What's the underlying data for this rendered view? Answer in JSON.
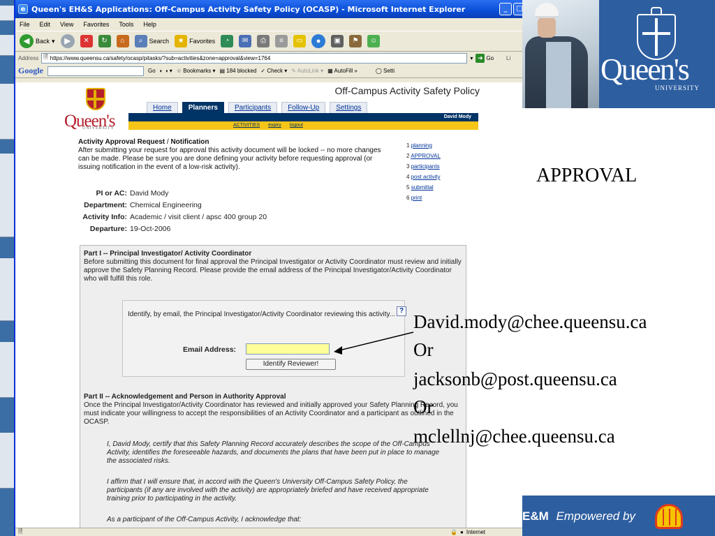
{
  "browser": {
    "title": "Queen's EH&S Applications: Off-Campus Activity Safety Policy (OCASP) - Microsoft Internet Explorer",
    "menu": [
      "File",
      "Edit",
      "View",
      "Favorites",
      "Tools",
      "Help"
    ],
    "toolbar": {
      "back": "Back",
      "search": "Search",
      "favorites": "Favorites"
    },
    "address_label": "Address",
    "url": "https://www.queensu.ca/safety/ocasp/pitasks/?sub=activities&zone=approval&view=1764",
    "go": "Go",
    "links": "Li",
    "google_toolbar": {
      "logo": "Google",
      "go": "Go",
      "bookmarks": "Bookmarks",
      "blocked": "184 blocked",
      "check": "Check",
      "autolink": "AutoLink",
      "autofill": "AutoFill",
      "settings": "Setti"
    },
    "status_zone": "Internet"
  },
  "page": {
    "logo_word": "Queen's",
    "logo_univ": "UNIVERSITY",
    "title": "Off-Campus Activity Safety Policy",
    "tabs": [
      {
        "label": "Home",
        "active": false
      },
      {
        "label": "Planners",
        "active": true
      },
      {
        "label": "Participants",
        "active": false
      },
      {
        "label": "Follow-Up",
        "active": false
      },
      {
        "label": "Settings",
        "active": false
      }
    ],
    "user": "David Mody",
    "subnav": [
      "ACTIVITIES",
      "expiry",
      "logout"
    ],
    "approval_heading_a": "Activity Approval Request",
    "approval_heading_sep": " / ",
    "approval_heading_b": "Notification",
    "approval_text": "After submitting your request for approval this activity document will be locked -- no more changes can be made. Please be sure you are done defining your activity before requesting approval (or issuing notification in the event of a low-risk activity).",
    "steps": [
      {
        "num": "1",
        "label": "planning"
      },
      {
        "num": "2",
        "label": "APPROVAL"
      },
      {
        "num": "3",
        "label": "participants"
      },
      {
        "num": "4",
        "label": "post activity"
      },
      {
        "num": "5",
        "label": "submittal"
      },
      {
        "num": "6",
        "label": "print"
      }
    ],
    "info": [
      {
        "k": "PI or AC:",
        "v": "David Mody"
      },
      {
        "k": "Department:",
        "v": "Chemical Engineering"
      },
      {
        "k": "Activity Info:",
        "v": "Academic / visit client / apsc 400 group 20"
      },
      {
        "k": "Departure:",
        "v": "19-Oct-2006"
      }
    ],
    "part1_heading": "Part I -- Principal Investigator/ Activity Coordinator",
    "part1_text": "Before submitting this document for final approval the Principal Investigator or Activity Coordinator must review and initially approve the Safety Planning Record. Please provide the email address of the Principal Investigator/Activity Coordinator who will fulfill this role.",
    "identify_text": "Identify, by email, the Principal Investigator/Activity Coordinator reviewing this activity...",
    "help": "?",
    "email_label": "Email Address:",
    "email_value": "",
    "identify_button": "Identify Reviewer!",
    "part2_heading": "Part II -- Acknowledgement and Person in Authority Approval",
    "part2_text": "Once the Principal Investigator/Activity Coordinator has reviewed and initially approved your Safety Planning Record, you must indicate your willingness to accept the responsibilities of an Activity Coordinator and a participant as outlined in the OCASP.",
    "certify1": "I, David Mody, certify that this Safety Planning Record accurately describes the scope of the Off-Campus Activity, identifies the foreseeable hazards, and documents the plans that have been put in place to manage the associated risks.",
    "certify2": "I affirm that I will ensure that, in accord with the Queen's University Off-Campus Safety Policy, the participants (if any are involved with the activity) are appropriately briefed and have received appropriate training prior to participating in the activity.",
    "certify3": "As a participant of the Off-Campus Activity, I acknowledge that:"
  },
  "slide": {
    "wordmark": "Queen's",
    "univ": "UNIVERSITY",
    "heading": "APPROVAL",
    "emails": [
      "David.mody@chee.queensu.ca",
      "Or",
      "jacksonb@post.queensu.ca",
      "Or",
      "mclellnj@chee.queensu.ca"
    ],
    "footer_brand": "E&M",
    "footer_tag": "Empowered by"
  },
  "colors": {
    "queens_red": "#b51f2a",
    "queens_blue": "#2d5ea0",
    "nav_blue": "#003366",
    "gold": "#f5c518",
    "input_yellow": "#ffff99"
  }
}
